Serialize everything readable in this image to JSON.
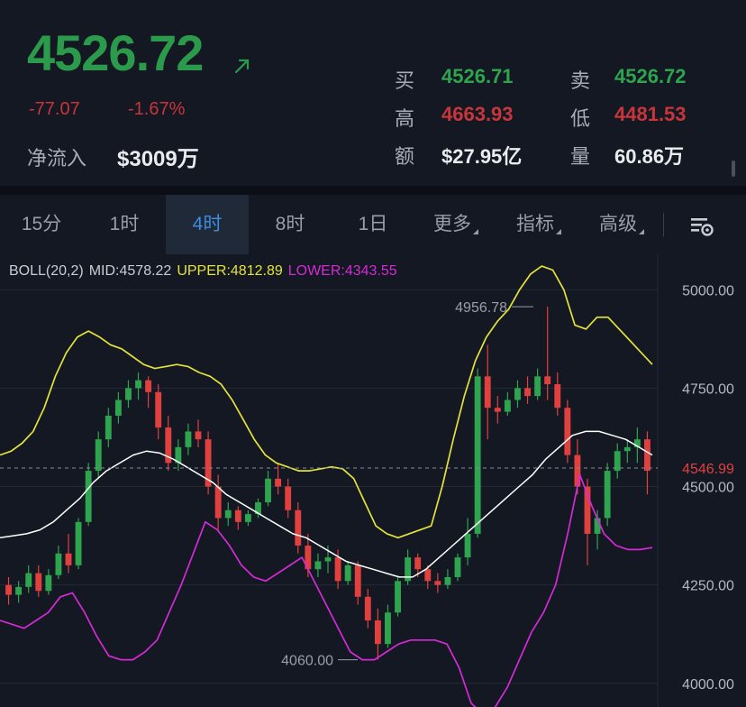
{
  "quote": {
    "last_price": "4526.72",
    "change": "-77.07",
    "change_pct": "-1.67%",
    "inflow_label": "净流入",
    "inflow_value": "$3009万",
    "bid_label": "买",
    "bid": "4526.71",
    "ask_label": "卖",
    "ask": "4526.72",
    "high_label": "高",
    "high": "4663.93",
    "low_label": "低",
    "low": "4481.53",
    "turnover_label": "额",
    "turnover": "$27.95亿",
    "volume_label": "量",
    "volume": "60.86万"
  },
  "tabs": [
    {
      "label": "15分"
    },
    {
      "label": "1时"
    },
    {
      "label": "4时",
      "active": true
    },
    {
      "label": "8时"
    },
    {
      "label": "1日"
    },
    {
      "label": "更多",
      "dropdown": true
    },
    {
      "label": "指标",
      "dropdown": true
    },
    {
      "label": "高级",
      "dropdown": true
    }
  ],
  "indicator": {
    "name": "BOLL(20,2)",
    "mid": "MID:4578.22",
    "upper": "UPPER:4812.89",
    "lower": "LOWER:4343.55"
  },
  "colors": {
    "up": "#2ea44f",
    "down": "#e0413f",
    "mid_line": "#ffffff",
    "upper_line": "#e5e23a",
    "lower_line": "#d62ad6",
    "active_tab": "#3c8de0"
  },
  "chart_data": {
    "type": "candlestick",
    "y_ticks": [
      "5000.00",
      "4750.00",
      "4500.00",
      "4250.00",
      "4000.00"
    ],
    "ylim": [
      3940,
      5090
    ],
    "current_price_label": "4546.99",
    "current_price": 4546.99,
    "max_marker": {
      "label": "4956.78",
      "value": 4956.78
    },
    "min_marker": {
      "label": "4060.00",
      "value": 4060.0
    },
    "upper_band": [
      4580,
      4590,
      4610,
      4640,
      4700,
      4780,
      4840,
      4880,
      4895,
      4880,
      4860,
      4850,
      4830,
      4810,
      4800,
      4805,
      4810,
      4805,
      4790,
      4780,
      4760,
      4720,
      4670,
      4620,
      4580,
      4560,
      4550,
      4540,
      4540,
      4545,
      4550,
      4545,
      4520,
      4460,
      4400,
      4380,
      4370,
      4380,
      4390,
      4400,
      4500,
      4620,
      4730,
      4820,
      4880,
      4920,
      4950,
      5000,
      5040,
      5060,
      5050,
      5000,
      4910,
      4900,
      4930,
      4930,
      4900,
      4870,
      4840,
      4810
    ],
    "mid_band": [
      4370,
      4375,
      4380,
      4390,
      4410,
      4440,
      4470,
      4510,
      4540,
      4560,
      4580,
      4590,
      4585,
      4570,
      4550,
      4530,
      4510,
      4480,
      4460,
      4440,
      4420,
      4400,
      4380,
      4370,
      4350,
      4330,
      4310,
      4300,
      4290,
      4280,
      4270,
      4270,
      4290,
      4320,
      4350,
      4380,
      4410,
      4440,
      4470,
      4500,
      4530,
      4570,
      4600,
      4630,
      4640,
      4640,
      4630,
      4620,
      4600,
      4580
    ],
    "lower_band": [
      4160,
      4150,
      4140,
      4160,
      4180,
      4220,
      4230,
      4180,
      4120,
      4070,
      4060,
      4060,
      4080,
      4110,
      4180,
      4250,
      4330,
      4410,
      4390,
      4350,
      4300,
      4270,
      4260,
      4280,
      4300,
      4320,
      4260,
      4200,
      4140,
      4080,
      4060,
      4060,
      4080,
      4100,
      4110,
      4110,
      4110,
      4100,
      4040,
      3950,
      3920,
      3940,
      3990,
      4060,
      4130,
      4180,
      4250,
      4380,
      4530,
      4450,
      4380,
      4350,
      4340,
      4340,
      4345
    ],
    "candles": [
      {
        "o": 4250,
        "h": 4270,
        "l": 4200,
        "c": 4225
      },
      {
        "o": 4225,
        "h": 4260,
        "l": 4205,
        "c": 4245
      },
      {
        "o": 4245,
        "h": 4300,
        "l": 4230,
        "c": 4280
      },
      {
        "o": 4280,
        "h": 4300,
        "l": 4220,
        "c": 4235
      },
      {
        "o": 4235,
        "h": 4290,
        "l": 4225,
        "c": 4275
      },
      {
        "o": 4275,
        "h": 4350,
        "l": 4265,
        "c": 4330
      },
      {
        "o": 4330,
        "h": 4380,
        "l": 4280,
        "c": 4300
      },
      {
        "o": 4300,
        "h": 4420,
        "l": 4290,
        "c": 4410
      },
      {
        "o": 4410,
        "h": 4560,
        "l": 4400,
        "c": 4540
      },
      {
        "o": 4540,
        "h": 4640,
        "l": 4520,
        "c": 4620
      },
      {
        "o": 4620,
        "h": 4700,
        "l": 4600,
        "c": 4680
      },
      {
        "o": 4680,
        "h": 4740,
        "l": 4660,
        "c": 4720
      },
      {
        "o": 4720,
        "h": 4770,
        "l": 4700,
        "c": 4750
      },
      {
        "o": 4750,
        "h": 4790,
        "l": 4720,
        "c": 4770
      },
      {
        "o": 4770,
        "h": 4780,
        "l": 4700,
        "c": 4740
      },
      {
        "o": 4740,
        "h": 4760,
        "l": 4620,
        "c": 4650
      },
      {
        "o": 4650,
        "h": 4680,
        "l": 4540,
        "c": 4560
      },
      {
        "o": 4560,
        "h": 4620,
        "l": 4540,
        "c": 4600
      },
      {
        "o": 4600,
        "h": 4660,
        "l": 4580,
        "c": 4640
      },
      {
        "o": 4640,
        "h": 4670,
        "l": 4600,
        "c": 4620
      },
      {
        "o": 4620,
        "h": 4640,
        "l": 4480,
        "c": 4500
      },
      {
        "o": 4500,
        "h": 4530,
        "l": 4390,
        "c": 4420
      },
      {
        "o": 4420,
        "h": 4460,
        "l": 4400,
        "c": 4440
      },
      {
        "o": 4440,
        "h": 4450,
        "l": 4390,
        "c": 4410
      },
      {
        "o": 4410,
        "h": 4440,
        "l": 4400,
        "c": 4430
      },
      {
        "o": 4430,
        "h": 4470,
        "l": 4420,
        "c": 4460
      },
      {
        "o": 4460,
        "h": 4540,
        "l": 4450,
        "c": 4520
      },
      {
        "o": 4520,
        "h": 4560,
        "l": 4480,
        "c": 4500
      },
      {
        "o": 4500,
        "h": 4520,
        "l": 4420,
        "c": 4440
      },
      {
        "o": 4440,
        "h": 4460,
        "l": 4330,
        "c": 4350
      },
      {
        "o": 4350,
        "h": 4380,
        "l": 4270,
        "c": 4290
      },
      {
        "o": 4290,
        "h": 4330,
        "l": 4270,
        "c": 4310
      },
      {
        "o": 4310,
        "h": 4350,
        "l": 4280,
        "c": 4320
      },
      {
        "o": 4320,
        "h": 4340,
        "l": 4240,
        "c": 4260
      },
      {
        "o": 4260,
        "h": 4310,
        "l": 4250,
        "c": 4300
      },
      {
        "o": 4300,
        "h": 4310,
        "l": 4200,
        "c": 4220
      },
      {
        "o": 4220,
        "h": 4240,
        "l": 4140,
        "c": 4160
      },
      {
        "o": 4160,
        "h": 4190,
        "l": 4060,
        "c": 4100
      },
      {
        "o": 4100,
        "h": 4200,
        "l": 4090,
        "c": 4180
      },
      {
        "o": 4180,
        "h": 4270,
        "l": 4170,
        "c": 4260
      },
      {
        "o": 4260,
        "h": 4340,
        "l": 4250,
        "c": 4320
      },
      {
        "o": 4320,
        "h": 4330,
        "l": 4270,
        "c": 4290
      },
      {
        "o": 4290,
        "h": 4300,
        "l": 4240,
        "c": 4260
      },
      {
        "o": 4260,
        "h": 4280,
        "l": 4230,
        "c": 4250
      },
      {
        "o": 4250,
        "h": 4290,
        "l": 4240,
        "c": 4270
      },
      {
        "o": 4270,
        "h": 4330,
        "l": 4260,
        "c": 4320
      },
      {
        "o": 4320,
        "h": 4420,
        "l": 4300,
        "c": 4380
      },
      {
        "o": 4380,
        "h": 4800,
        "l": 4370,
        "c": 4780
      },
      {
        "o": 4780,
        "h": 4860,
        "l": 4620,
        "c": 4700
      },
      {
        "o": 4700,
        "h": 4730,
        "l": 4660,
        "c": 4690
      },
      {
        "o": 4690,
        "h": 4740,
        "l": 4680,
        "c": 4720
      },
      {
        "o": 4720,
        "h": 4770,
        "l": 4700,
        "c": 4750
      },
      {
        "o": 4750,
        "h": 4780,
        "l": 4710,
        "c": 4730
      },
      {
        "o": 4730,
        "h": 4800,
        "l": 4720,
        "c": 4780
      },
      {
        "o": 4780,
        "h": 4957,
        "l": 4720,
        "c": 4760
      },
      {
        "o": 4760,
        "h": 4790,
        "l": 4680,
        "c": 4700
      },
      {
        "o": 4700,
        "h": 4720,
        "l": 4560,
        "c": 4580
      },
      {
        "o": 4580,
        "h": 4620,
        "l": 4480,
        "c": 4500
      },
      {
        "o": 4500,
        "h": 4520,
        "l": 4300,
        "c": 4380
      },
      {
        "o": 4380,
        "h": 4440,
        "l": 4340,
        "c": 4420
      },
      {
        "o": 4420,
        "h": 4560,
        "l": 4400,
        "c": 4540
      },
      {
        "o": 4540,
        "h": 4610,
        "l": 4520,
        "c": 4590
      },
      {
        "o": 4590,
        "h": 4620,
        "l": 4560,
        "c": 4600
      },
      {
        "o": 4600,
        "h": 4650,
        "l": 4560,
        "c": 4620
      },
      {
        "o": 4620,
        "h": 4640,
        "l": 4480,
        "c": 4540
      }
    ]
  }
}
